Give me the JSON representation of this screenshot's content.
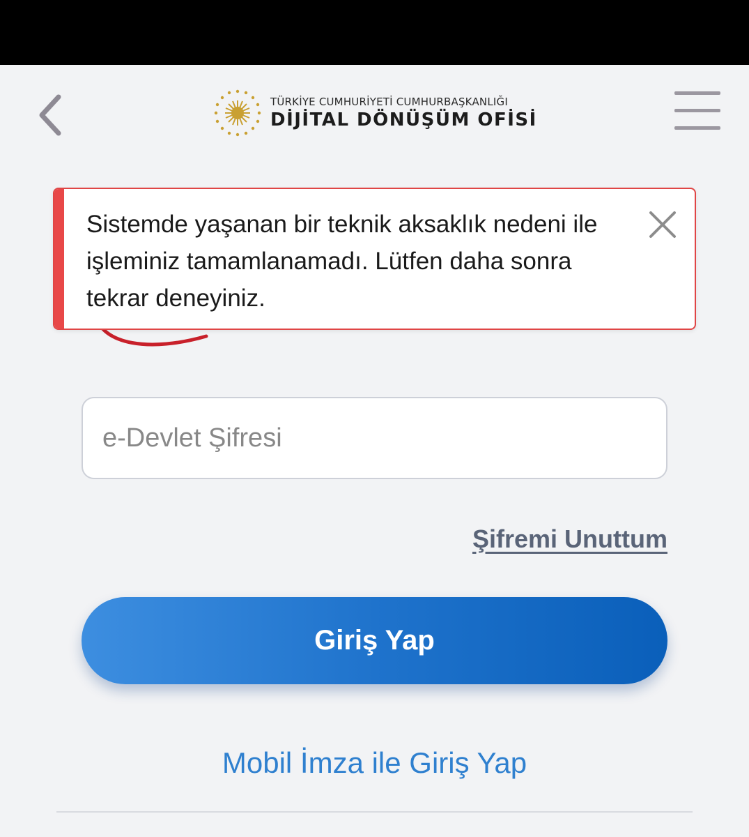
{
  "header": {
    "back_icon": "chevron-left-icon",
    "logo": {
      "emblem_icon": "presidential-emblem-icon",
      "line1": "TÜRKİYE CUMHURİYETİ CUMHURBAŞKANLIĞI",
      "line2": "DİJİTAL DÖNÜŞÜM OFİSİ"
    },
    "menu_icon": "hamburger-menu-icon"
  },
  "alert": {
    "message": "Sistemde yaşanan bir teknik aksaklık nedeni ile işleminiz tamamlanamadı. Lütfen daha sonra tekrar deneyiniz.",
    "close_icon": "close-icon",
    "accent_color": "#e84848"
  },
  "form": {
    "password_placeholder": "e-Devlet Şifresi",
    "password_value": "",
    "forgot_password_label": "Şifremi Unuttum",
    "login_button_label": "Giriş Yap",
    "mobile_signature_label": "Mobil İmza ile Giriş Yap"
  },
  "colors": {
    "background": "#f2f3f5",
    "primary": "#1f73cc",
    "link": "#2f80cf"
  }
}
